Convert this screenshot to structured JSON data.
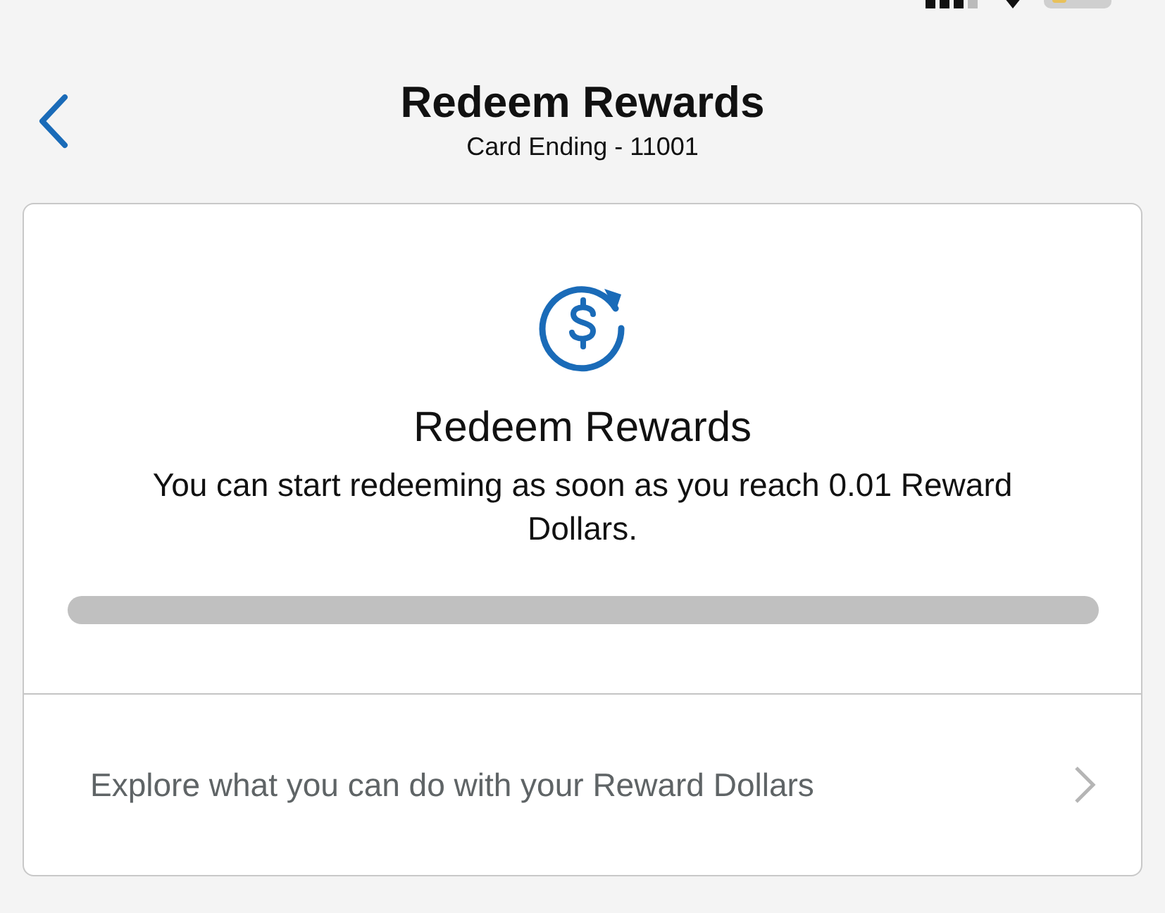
{
  "header": {
    "title": "Redeem Rewards",
    "subtitle": "Card Ending - 11001"
  },
  "card": {
    "heading": "Redeem Rewards",
    "message": "You can start redeeming as soon as you reach 0.01 Reward Dollars.",
    "progress": {
      "level": 0
    }
  },
  "link": {
    "label": "Explore what you can do with your Reward Dollars"
  }
}
